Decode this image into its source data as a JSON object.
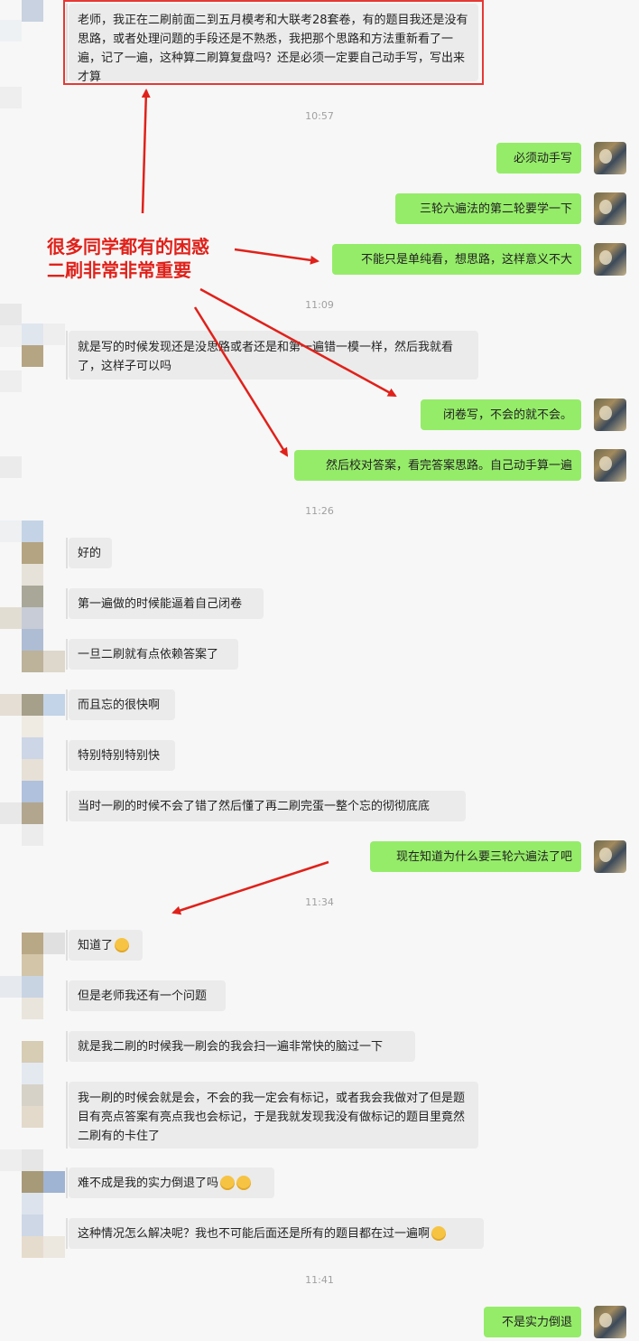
{
  "messages": {
    "m1": "老师，我正在二刷前面二到五月模考和大联考28套卷，有的题目我还是没有思路，或者处理问题的手段还是不熟悉，我把那个思路和方法重新看了一遍，记了一遍，这种算二刷算复盘吗？还是必须一定要自己动手写，写出来才算",
    "t1": "10:57",
    "m2": "必须动手写",
    "m3": "三轮六遍法的第二轮要学一下",
    "m4": "不能只是单纯看，想思路，这样意义不大",
    "t2": "11:09",
    "m5": "就是写的时候发现还是没思路或者还是和第一遍错一模一样，然后我就看了，这样子可以吗",
    "m6": "闭卷写，不会的就不会。",
    "m7": "然后校对答案，看完答案思路。自己动手算一遍",
    "t3": "11:26",
    "m8": "好的",
    "m9": "第一遍做的时候能逼着自己闭卷",
    "m10": "一旦二刷就有点依赖答案了",
    "m11": "而且忘的很快啊",
    "m12": "特别特别特别快",
    "m13": "当时一刷的时候不会了错了然后懂了再二刷完蛋一整个忘的彻彻底底",
    "m14": "现在知道为什么要三轮六遍法了吧",
    "t4": "11:34",
    "m15": "知道了",
    "m16": "但是老师我还有一个问题",
    "m17": "就是我二刷的时候我一刷会的我会扫一遍非常快的脑过一下",
    "m18": "我一刷的时候会就是会，不会的我一定会有标记，或者我会我做对了但是题目有亮点答案有亮点我也会标记，于是我就发现我没有做标记的题目里竟然二刷有的卡住了",
    "m19": "难不成是我的实力倒退了吗",
    "m20": "这种情况怎么解决呢？我也不可能后面还是所有的题目都在过一遍啊",
    "t5": "11:41",
    "m21": "不是实力倒退"
  },
  "annotation": {
    "line1": "很多同学都有的困惑",
    "line2": "二刷非常非常重要"
  },
  "colors": {
    "sent_bubble": "#95ec69",
    "received_bubble": "#ebebeb",
    "annotation_red": "#e0211a"
  },
  "icons": [
    "avatar",
    "emoji-crying-face",
    "emoji-facepalm"
  ]
}
